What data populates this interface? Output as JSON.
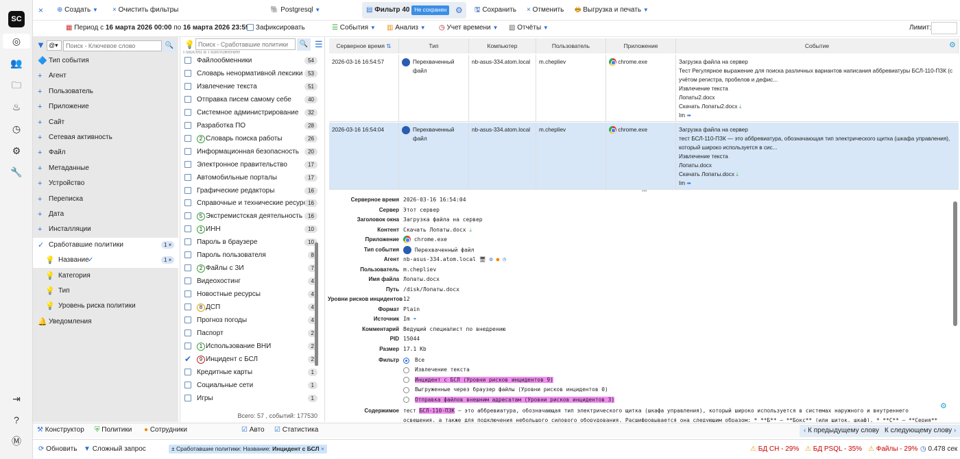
{
  "rail": {
    "logo": "SC"
  },
  "toolbar": {
    "close": "×",
    "create": "Создать",
    "clear": "Очистить фильтры",
    "db": "Postgresql",
    "filter_tab": "Фильтр 40",
    "not_saved": "Не сохранен",
    "save": "Сохранить",
    "cancel": "Отменить",
    "export": "Выгрузка и печать"
  },
  "row2": {
    "period_prefix": "Период с",
    "date_from": "16 марта 2026 00:00",
    "by": "по",
    "date_to": "16 марта 2026 23:59",
    "fixed": "Зафиксировать",
    "events": "События",
    "analysis": "Анализ",
    "time": "Учет времени",
    "reports": "Отчёты",
    "limit": "Лимит:"
  },
  "tree": {
    "search_placeholder": "Поиск - Ключевое слово",
    "mode": "@",
    "items": [
      {
        "label": "Тип события"
      },
      {
        "label": "Агент"
      },
      {
        "label": "Пользователь"
      },
      {
        "label": "Приложение"
      },
      {
        "label": "Сайт"
      },
      {
        "label": "Сетевая активность"
      },
      {
        "label": "Файл"
      },
      {
        "label": "Метаданные"
      },
      {
        "label": "Устройство"
      },
      {
        "label": "Переписка"
      },
      {
        "label": "Дата"
      },
      {
        "label": "Инсталляции"
      },
      {
        "label": "Сработавшие политики",
        "count": "1"
      },
      {
        "label": "Название",
        "count": "1"
      },
      {
        "label": "Категория"
      },
      {
        "label": "Тип"
      },
      {
        "label": "Уровень риска политики"
      },
      {
        "label": "Уведомления"
      }
    ]
  },
  "list": {
    "search_placeholder": "Поиск - Сработавшие политики",
    "top_partial": "Парсер в Приложение",
    "items": [
      {
        "label": "Файлообменники",
        "count": "54"
      },
      {
        "label": "Словарь ненормативной лексики",
        "count": "53"
      },
      {
        "label": "Извлечение текста",
        "count": "51"
      },
      {
        "label": "Отправка писем самому себе",
        "count": "40"
      },
      {
        "label": "Системное администрирование",
        "count": "32"
      },
      {
        "label": "Разработка ПО",
        "count": "28"
      },
      {
        "label": "Словарь поиска работы",
        "count": "26",
        "mark": "2"
      },
      {
        "label": "Информационная безопасность",
        "count": "20"
      },
      {
        "label": "Электронное правительство",
        "count": "17"
      },
      {
        "label": "Автомобильные порталы",
        "count": "17"
      },
      {
        "label": "Графические редакторы",
        "count": "16"
      },
      {
        "label": "Справочные и технические ресурсы",
        "count": "16"
      },
      {
        "label": "Экстремистская деятельность",
        "count": "16",
        "mark": "5"
      },
      {
        "label": "ИНН",
        "count": "10",
        "mark": "1"
      },
      {
        "label": "Пароль в браузере",
        "count": "10"
      },
      {
        "label": "Пароль пользователя",
        "count": "8"
      },
      {
        "label": "Файлы с ЗИ",
        "count": "7",
        "mark": "2"
      },
      {
        "label": "Видеохостинг",
        "count": "4"
      },
      {
        "label": "Новостные ресурсы",
        "count": "4"
      },
      {
        "label": "ДСП",
        "count": "4",
        "mark": "8"
      },
      {
        "label": "Прогноз погоды",
        "count": "4"
      },
      {
        "label": "Паспорт",
        "count": "2"
      },
      {
        "label": "Использование ВНИ",
        "count": "2",
        "mark": "1"
      },
      {
        "label": "Инцидент с БСЛ",
        "count": "2",
        "mark": "9",
        "checked": true
      },
      {
        "label": "Кредитные карты",
        "count": "1"
      },
      {
        "label": "Социальные сети",
        "count": "1"
      },
      {
        "label": "Игры",
        "count": "1"
      }
    ],
    "total": "Всего: 57 , событий: 177530"
  },
  "grid": {
    "headers": [
      "Серверное время",
      "Тип",
      "Компьютер",
      "Пользователь",
      "Приложение",
      "Событие"
    ],
    "rows": [
      {
        "time": "2026-03-16 16:54:57",
        "type": "Перехваченный файл",
        "computer": "nb-asus-334.atom.local",
        "user": "m.chepliev",
        "app": "chrome.exe",
        "ev1": "Загрузка файла на сервер",
        "ev2": "Тест Регулярное выражение для поиска различных вариантов написания аббревиатуры БСЛ-110-ПЗК (с",
        "ev3": "учётом регистра, пробелов и дефис...",
        "ev4": "Извлечение текста",
        "ev5": "Лопаты2.docx",
        "ev6": "Скачать Лопаты2.docx",
        "ev7": "Im"
      },
      {
        "time": "2026-03-16 16:54:04",
        "type": "Перехваченный файл",
        "computer": "nb-asus-334.atom.local",
        "user": "m.chepliev",
        "app": "chrome.exe",
        "ev1": "Загрузка файла на сервер",
        "ev2": "тест БСЛ-110-ПЗК — это аббревиатура, обозначающая тип электрического щитка (шкафа управления),",
        "ev3": "который широко используется в сис...",
        "ev4": "Извлечение текста",
        "ev5": "Лопаты.docx",
        "ev6": "Скачать Лопаты.docx",
        "ev7": "Im"
      }
    ]
  },
  "detail": {
    "fields": [
      {
        "k": "Серверное время",
        "v": "2026-03-16 16:54:04"
      },
      {
        "k": "Сервер",
        "v": "Этот сервер"
      },
      {
        "k": "Заголовок окна",
        "v": "Загрузка файла на сервер"
      },
      {
        "k": "Контент",
        "v": "Скачать Лопаты.docx"
      },
      {
        "k": "Приложение",
        "v": "chrome.exe"
      },
      {
        "k": "Тип события",
        "v": "Перехваченный файл"
      },
      {
        "k": "Агент",
        "v": "nb-asus-334.atom.local"
      },
      {
        "k": "Пользователь",
        "v": "m.chepliev"
      },
      {
        "k": "Имя файла",
        "v": "Лопаты.docx"
      },
      {
        "k": "Путь",
        "v": "/disk/Лопаты.docx"
      },
      {
        "k": "Уровни рисков инцидентов",
        "v": "12"
      },
      {
        "k": "Формат",
        "v": "Plain"
      },
      {
        "k": "Источник",
        "v": "Im"
      },
      {
        "k": "Комментарий",
        "v": "Ведущий специалист по внедрению"
      },
      {
        "k": "PID",
        "v": "15044"
      },
      {
        "k": "Размер",
        "v": "17.1 Kb"
      }
    ],
    "filter_label": "Фильтр",
    "filters": [
      {
        "v": "Все",
        "hl": false
      },
      {
        "v": "Извлечение текста",
        "hl": false
      },
      {
        "v": "Инцидент с БСЛ (Уровни рисков инцидентов 9)",
        "hl": true
      },
      {
        "v": "Выгруженные через браузер файлы (Уровни рисков инцидентов 0)",
        "hl": false
      },
      {
        "v": "Отправка файлов внешним адресатам (Уровни рисков инцидентов 3)",
        "hl": true
      }
    ],
    "content_label": "Содержимое",
    "content_pre": "тест ",
    "content_hl": "БСЛ-110-ПЗК",
    "content_post": " — это аббревиатура, обозначающая тип электрического щитка (шкафа управления), который широко используется в системах наружного и внутреннего",
    "content_line2": "освещения, а также для подключения небольшого силового оборудования. Расшифровывается она следующим образом: * **Б** — **Бокс** (или щиток, шкаф). * **С** — **Серия**"
  },
  "bottom": {
    "constructor": "Конструктор",
    "policies": "Политики",
    "employees": "Сотрудники",
    "auto": "Авто",
    "stats": "Статистика",
    "prev": "К предыдущему слову",
    "next": "К следующему слову"
  },
  "status": {
    "refresh": "Обновить",
    "complex": "Сложный запрос",
    "chip": "± Сработавшие политики: Название: ",
    "chip_bold": "Инцидент с БСЛ",
    "ch": "БД CH - 29%",
    "psql": "БД PSQL - 35%",
    "files": "Файлы - 29%",
    "time": "0.478 сек"
  }
}
